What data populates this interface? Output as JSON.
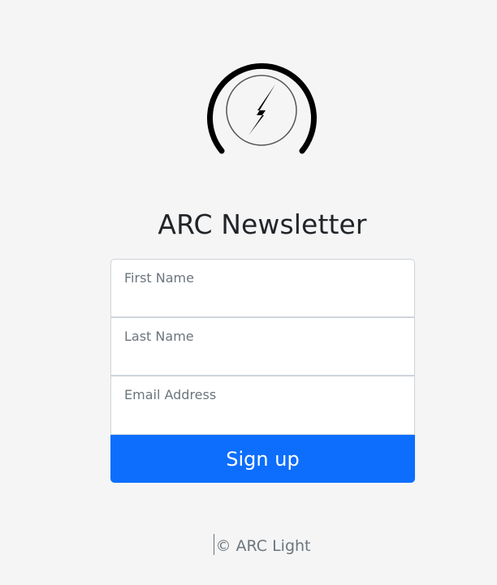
{
  "logo": {
    "icon": "lightning-bolt-icon"
  },
  "title": "ARC Newsletter",
  "form": {
    "fields": [
      {
        "label": "First Name",
        "value": ""
      },
      {
        "label": "Last Name",
        "value": ""
      },
      {
        "label": "Email Address",
        "value": ""
      }
    ],
    "submit_label": "Sign up"
  },
  "footer": {
    "text": "© ARC Light"
  },
  "colors": {
    "background": "#f5f5f5",
    "primary": "#0d6efd",
    "text": "#212529",
    "muted": "#6c757d",
    "border": "#ced4da"
  }
}
